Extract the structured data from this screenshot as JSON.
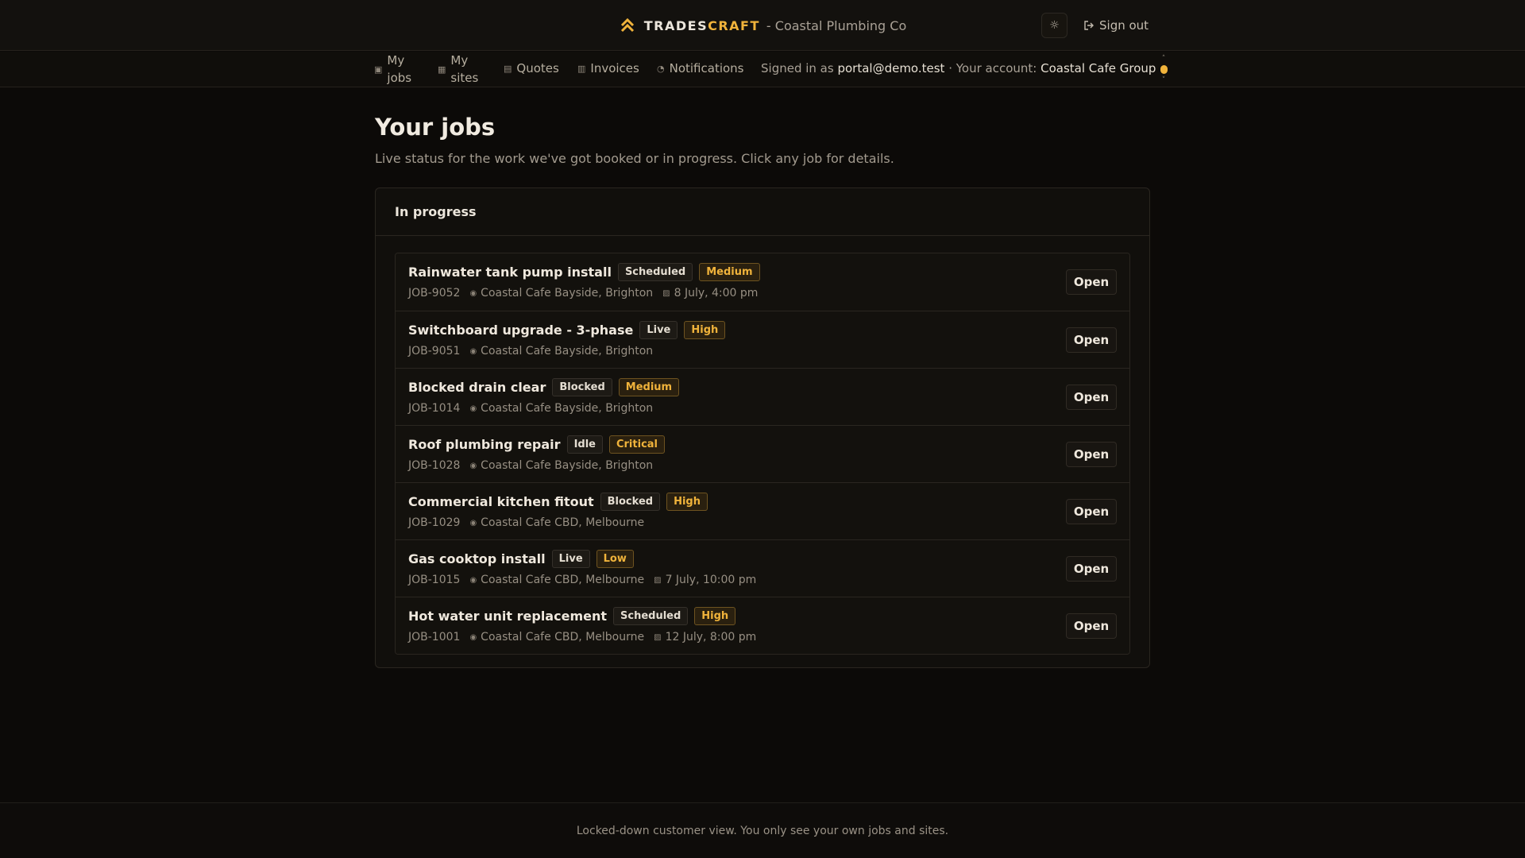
{
  "header": {
    "brand_trades": "TRADES",
    "brand_craft": "CRAFT",
    "company": "- Coastal Plumbing Co",
    "signout_label": "Sign out",
    "accent": "#f0b33b"
  },
  "nav": {
    "items": [
      {
        "label_line1": "My",
        "label_line2": "jobs",
        "icon": "briefcase-icon"
      },
      {
        "label_line1": "My",
        "label_line2": "sites",
        "icon": "building-icon"
      },
      {
        "label": "Quotes",
        "icon": "document-icon"
      },
      {
        "label": "Invoices",
        "icon": "receipt-icon"
      },
      {
        "label": "Notifications",
        "icon": "bell-icon"
      }
    ],
    "signed_in_prefix": "Signed in as",
    "user_email": "portal@demo.test",
    "account_prefix": "· Your account:",
    "account_name": "Coastal Cafe Group"
  },
  "main": {
    "title": "Your jobs",
    "subtitle": "Live status for the work we've got booked or in progress. Click any job for details.",
    "section_title": "In progress",
    "open_label": "Open",
    "jobs": [
      {
        "title": "Rainwater tank pump install",
        "status": "Scheduled",
        "priority": "Medium",
        "id": "JOB-9052",
        "site": "Coastal Cafe Bayside, Brighton",
        "date": "8 July, 4:00 pm"
      },
      {
        "title": "Switchboard upgrade - 3-phase",
        "status": "Live",
        "priority": "High",
        "id": "JOB-9051",
        "site": "Coastal Cafe Bayside, Brighton",
        "date": ""
      },
      {
        "title": "Blocked drain clear",
        "status": "Blocked",
        "priority": "Medium",
        "id": "JOB-1014",
        "site": "Coastal Cafe Bayside, Brighton",
        "date": ""
      },
      {
        "title": "Roof plumbing repair",
        "status": "Idle",
        "priority": "Critical",
        "id": "JOB-1028",
        "site": "Coastal Cafe Bayside, Brighton",
        "date": ""
      },
      {
        "title": "Commercial kitchen fitout",
        "status": "Blocked",
        "priority": "High",
        "id": "JOB-1029",
        "site": "Coastal Cafe CBD, Melbourne",
        "date": ""
      },
      {
        "title": "Gas cooktop install",
        "status": "Live",
        "priority": "Low",
        "id": "JOB-1015",
        "site": "Coastal Cafe CBD, Melbourne",
        "date": "7 July, 10:00 pm"
      },
      {
        "title": "Hot water unit replacement",
        "status": "Scheduled",
        "priority": "High",
        "id": "JOB-1001",
        "site": "Coastal Cafe CBD, Melbourne",
        "date": "12 July, 8:00 pm"
      }
    ]
  },
  "footer": {
    "text": "Locked-down customer view. You only see your own jobs and sites."
  }
}
